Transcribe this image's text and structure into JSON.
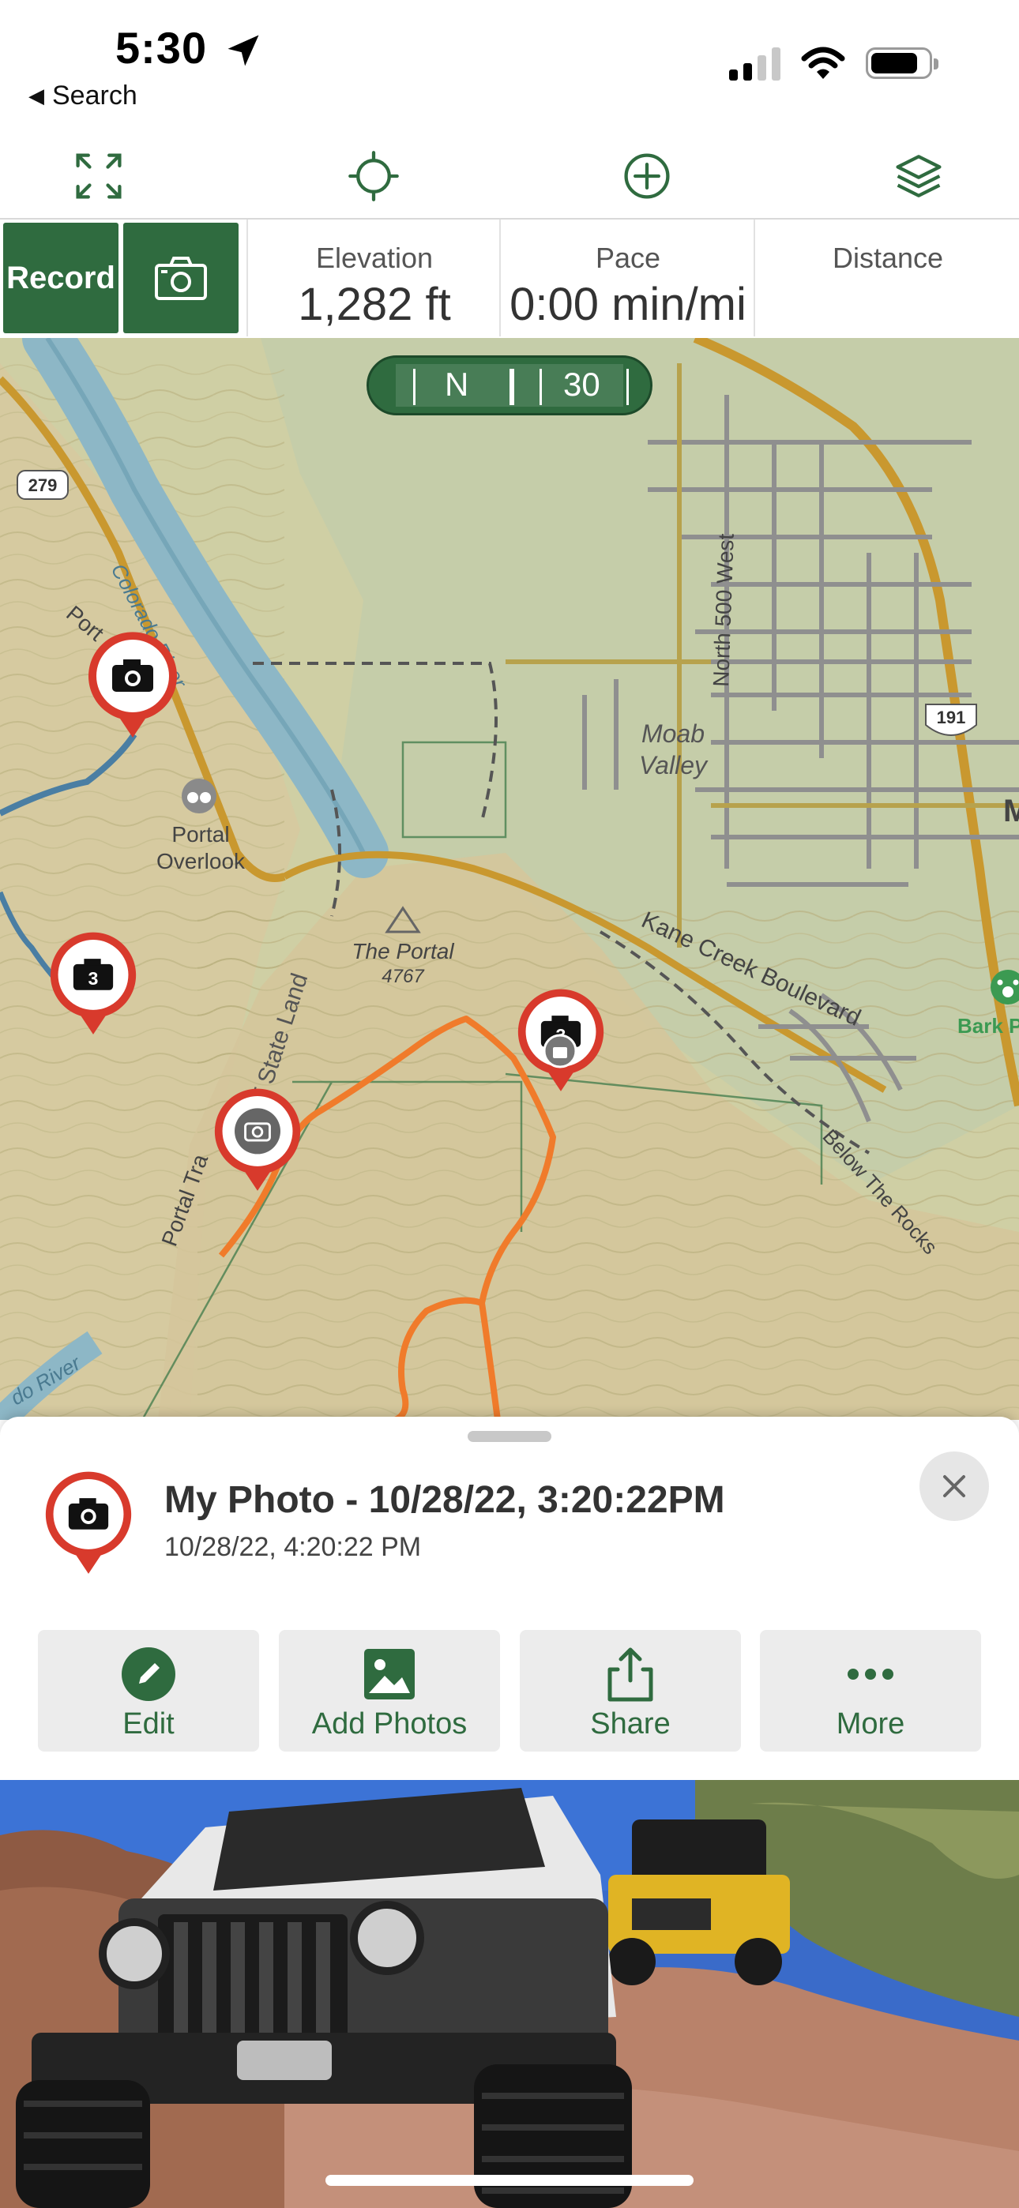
{
  "status_bar": {
    "time": "5:30",
    "back_label": "Search",
    "icons": [
      "location-arrow-icon",
      "cellular-signal-icon",
      "wifi-icon",
      "battery-icon"
    ]
  },
  "toolbar": {
    "icons": [
      "expand-icon",
      "locate-crosshair-icon",
      "add-circle-icon",
      "layers-icon"
    ]
  },
  "stats": {
    "record_label": "Record",
    "camera_icon": "camera-icon",
    "items": [
      {
        "label": "Elevation",
        "value": "1,282 ft"
      },
      {
        "label": "Pace",
        "value": "0:00 min/mi"
      },
      {
        "label": "Distance",
        "value": ""
      }
    ]
  },
  "compass": {
    "direction": "N",
    "degrees": "30"
  },
  "map": {
    "labels": {
      "colorado_river": "Colorado River",
      "colorado_river_lower": "do River",
      "portal": "Port",
      "portal_overlook_1": "Portal",
      "portal_overlook_2": "Overlook",
      "ut_state_land": "UT State Land",
      "the_portal": "The Portal",
      "the_portal_elev": "4767",
      "portal_trail": "Portal Tra",
      "moab_valley_1": "Moab",
      "moab_valley_2": "Valley",
      "north_500_west": "North 500 West",
      "kane_creek": "Kane Creek Boulevard",
      "below_the_rocks": "Below The Rocks",
      "bark_park": "Bark P",
      "moab_m": "M",
      "route_279": "279",
      "route_191": "191"
    },
    "colors": {
      "terrain": "#cfcfa4",
      "river": "#8db7c6",
      "road": "#c9982f",
      "track": "#f07b2b",
      "pin": "#d83a2c",
      "accent_green": "#2f6b3f"
    }
  },
  "sheet": {
    "title": "My Photo - 10/28/22, 3:20:22PM",
    "subtitle": "10/28/22, 4:20:22 PM",
    "actions": [
      {
        "label": "Edit",
        "icon": "pencil-icon"
      },
      {
        "label": "Add Photos",
        "icon": "image-icon"
      },
      {
        "label": "Share",
        "icon": "share-icon"
      },
      {
        "label": "More",
        "icon": "more-dots-icon"
      }
    ]
  }
}
